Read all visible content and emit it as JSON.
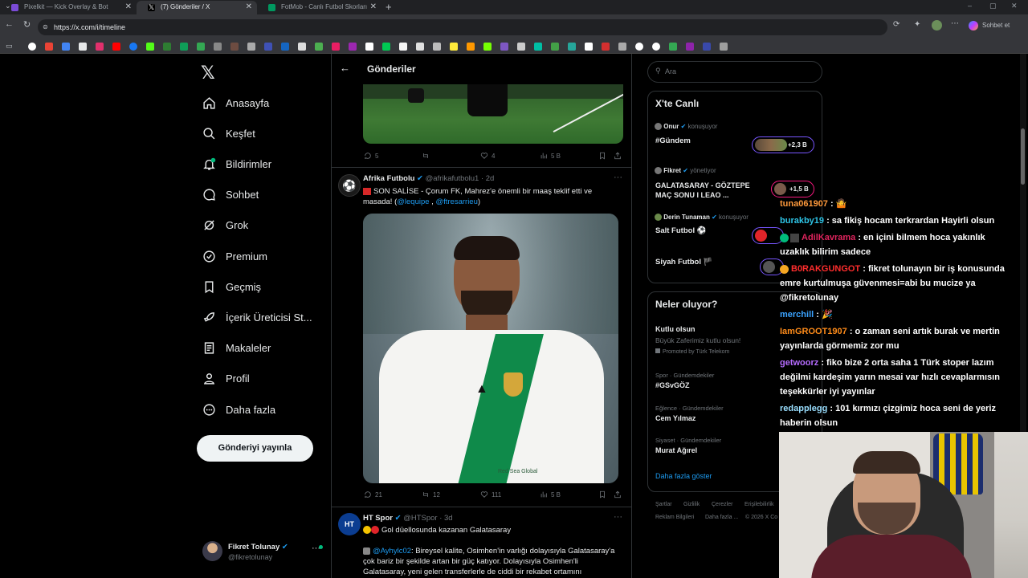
{
  "browser": {
    "tabs": [
      {
        "title": "Pixelkit — Kick Overlay & Bot",
        "color": "#7b4bd6"
      },
      {
        "title": "(7) Gönderiler / X",
        "color": "#ffffff"
      },
      {
        "title": "FotMob - Canlı Futbol Skorları",
        "color": "#00985f"
      }
    ],
    "url": "https://x.com/i/timeline",
    "profile_label": "Sohbet et"
  },
  "nav": {
    "items": [
      {
        "label": "Anasayfa",
        "icon": "home-icon"
      },
      {
        "label": "Keşfet",
        "icon": "search-icon"
      },
      {
        "label": "Bildirimler",
        "icon": "bell-icon"
      },
      {
        "label": "Sohbet",
        "icon": "chat-icon"
      },
      {
        "label": "Grok",
        "icon": "grok-icon"
      },
      {
        "label": "Premium",
        "icon": "premium-icon"
      },
      {
        "label": "Geçmiş",
        "icon": "bookmark-icon"
      },
      {
        "label": "İçerik Üreticisi St...",
        "icon": "rocket-icon"
      },
      {
        "label": "Makaleler",
        "icon": "article-icon"
      },
      {
        "label": "Profil",
        "icon": "profile-icon"
      },
      {
        "label": "Daha fazla",
        "icon": "more-icon"
      }
    ],
    "post_button": "Gönderiyi yayınla",
    "account": {
      "name": "Fikret Tolunay",
      "handle": "@fikretolunay"
    }
  },
  "timeline": {
    "header": "Gönderiler",
    "post0_actions": {
      "replies": "5",
      "likes": "4",
      "views": "5 B"
    },
    "post1": {
      "author": "Afrika Futbolu",
      "handle": "@afrikafutbolu1",
      "time": "· 2d",
      "text": "SON SALİSE - Çorum FK, Mahrez'e önemli bir maaş teklif etti ve masada!",
      "mention1": "@lequipe",
      "mention2": "@ftresarrieu",
      "jersey_text": "Red Sea Global",
      "replies": "21",
      "reposts": "12",
      "likes": "111",
      "views": "5 B"
    },
    "post2": {
      "author": "HT Spor",
      "handle": "@HTSpor",
      "time": "· 3d",
      "title": "Gol düellosunda kazanan Galatasaray",
      "mention": "@Ayhylc02",
      "body": ": Bireysel kalite, Osimhen'in varlığı dolayısıyla Galatasaray'a çok bariz bir şekilde artan bir güç katıyor. Dolayısıyla Osimhen'li Galatasaray, yeni gelen transferlerle de ciddi bir rekabet ortamını"
    }
  },
  "right": {
    "search_placeholder": "Ara",
    "live_title": "X'te Canlı",
    "live": [
      {
        "host": "Onur",
        "role": "konuşuyor",
        "title": "#Gündem",
        "count": "+2,3 B"
      },
      {
        "host": "Fikret",
        "role": "yönetiyor",
        "title": "GALATASARAY - GÖZTEPE MAÇ SONU I LEAO ...",
        "count": "+1,5 B"
      },
      {
        "host": "Derin Tunaman",
        "role": "konuşuyor",
        "title": "Salt Futbol ⚽",
        "count": ""
      },
      {
        "host": "",
        "role": "",
        "title": "Siyah Futbol 🏴",
        "count": ""
      }
    ],
    "trends_title": "Neler oluyor?",
    "trends": [
      {
        "context": "",
        "name": "Kutlu olsun",
        "sub": "Büyük Zaferimiz kutlu olsun!",
        "promo": "Promoted by Türk Telekom"
      },
      {
        "context": "Spor · Gündemdekiler",
        "name": "#GSvGÖZ",
        "sub": "",
        "promo": ""
      },
      {
        "context": "Eğlence · Gündemdekiler",
        "name": "Cem Yılmaz",
        "sub": "",
        "promo": ""
      },
      {
        "context": "Siyaset · Gündemdekiler",
        "name": "Murat Ağırel",
        "sub": "",
        "promo": ""
      }
    ],
    "show_more": "Daha fazla göster",
    "footer": [
      "Şartlar",
      "Gizlilik",
      "Çerezler",
      "Erişilebilirlik",
      "Reklam Bilgileri",
      "Daha fazla ...",
      "© 2026 X Co"
    ]
  },
  "chat": [
    {
      "user": "tuna061907",
      "color": "#ff9a3c",
      "msg": " : 🤷"
    },
    {
      "user": "burakby19",
      "color": "#2ec4e6",
      "msg": " : sa fikiş hocam terkrardan Hayirli olsun"
    },
    {
      "user": "AdilKavrama",
      "color": "#e0245e",
      "msg": " : en içini bilmem hoca yakınlık uzaklık bilirim sadece"
    },
    {
      "user": "B0RAKGUNGOT",
      "color": "#ff2d2d",
      "msg": " : fikret tolunayın bir iş konusunda emre kurtulmuşa güvenmesi=abi bu mucize ya @fikretolunay"
    },
    {
      "user": "merchill",
      "color": "#3ba3ff",
      "msg": " : 🎉"
    },
    {
      "user": "IamGROOT1907",
      "color": "#ff8c1a",
      "msg": " : o zaman seni artık burak ve mertin yayınlarda görmemiz zor mu"
    },
    {
      "user": "getwoorz",
      "color": "#b66cff",
      "msg": " : fiko bize 2 orta saha 1 Türk stoper lazım değilmi kardeşim yarın mesai var hızlı cevaplarmısın teşekkürler iyi yayınlar"
    },
    {
      "user": "redapplegg",
      "color": "#9adfff",
      "msg": " : 101 kırmızı çizgimiz hoca seni de yeriz haberin olsun"
    }
  ]
}
